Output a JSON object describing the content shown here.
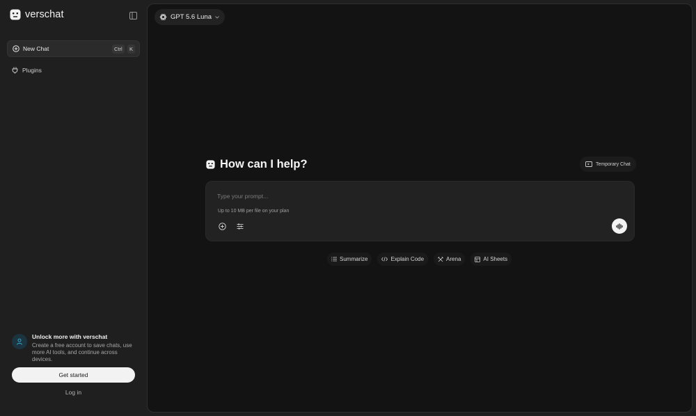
{
  "sidebar": {
    "brand_name": "verschat",
    "new_chat": {
      "label": "New Chat",
      "shortcut_mod": "Ctrl",
      "shortcut_key": "K"
    },
    "plugins_label": "Plugins",
    "promo": {
      "title": "Unlock more with verschat",
      "text": "Create a free account to save chats, use more AI tools, and continue across devices."
    },
    "get_started_label": "Get started",
    "login_label": "Log in"
  },
  "header": {
    "model_name": "GPT 5.6 Luna"
  },
  "main": {
    "heading": "How can I help?",
    "temporary_chat_label": "Temporary Chat",
    "prompt": {
      "placeholder": "Type your prompt...",
      "value": "",
      "hint": "Up to 10 MB per file on your plan"
    },
    "chips": [
      {
        "label": "Summarize",
        "icon": "list-icon"
      },
      {
        "label": "Explain Code",
        "icon": "code-icon"
      },
      {
        "label": "Arena",
        "icon": "arena-icon"
      },
      {
        "label": "AI Sheets",
        "icon": "table-icon"
      }
    ]
  },
  "colors": {
    "sidebar_bg": "#1f1f1f",
    "main_bg": "#131313",
    "prompt_bg": "#222222",
    "accent_light": "#f2f2f2",
    "avatar_bg": "#1b3440",
    "avatar_icon": "#3aa3c7"
  }
}
